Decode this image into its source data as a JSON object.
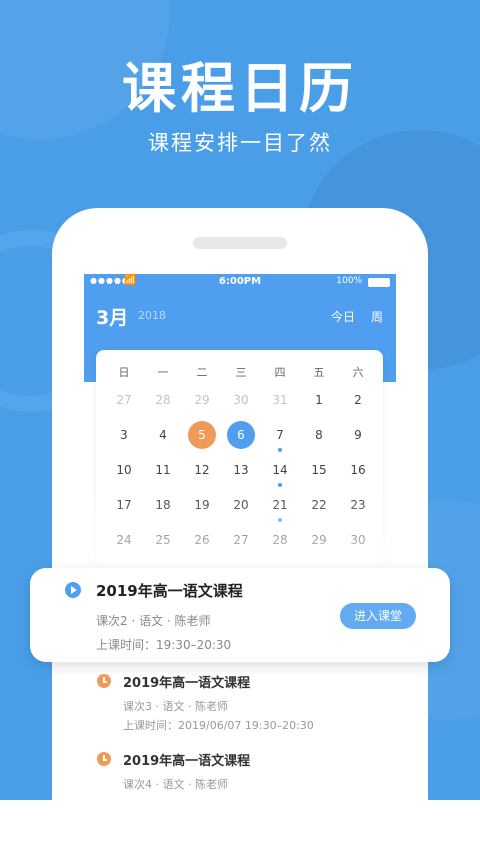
{
  "header": {
    "title": "课程日历",
    "subtitle": "课程安排一目了然"
  },
  "status_bar": {
    "signal": "●●●●●",
    "time": "6:00PM",
    "battery": "100%"
  },
  "calendar": {
    "month": "3月",
    "year": "2018",
    "today_label": "今日",
    "week_label": "周",
    "weekdays": [
      "日",
      "一",
      "二",
      "三",
      "四",
      "五",
      "六"
    ],
    "weeks": [
      [
        "27",
        "28",
        "29",
        "30",
        "31",
        "1",
        "2"
      ],
      [
        "3",
        "4",
        "5",
        "6",
        "7",
        "8",
        "9"
      ],
      [
        "10",
        "11",
        "12",
        "13",
        "14",
        "15",
        "16"
      ],
      [
        "17",
        "18",
        "19",
        "20",
        "21",
        "22",
        "23"
      ],
      [
        "24",
        "25",
        "26",
        "27",
        "28",
        "29",
        "30"
      ]
    ],
    "prev_month_days": 5,
    "highlight_orange": "5",
    "highlight_blue": "6",
    "dot_days": [
      "7",
      "14",
      "21"
    ]
  },
  "highlighted_course": {
    "title": "2019年高一语文课程",
    "meta": "课次2 · 语文 · 陈老师",
    "time": "上课时间：19:30–20:30",
    "enter_label": "进入课堂"
  },
  "course_list": [
    {
      "title": "2019年高一语文课程",
      "meta": "课次3 · 语文 · 陈老师",
      "time": "上课时间：2019/06/07 19:30–20:30"
    },
    {
      "title": "2019年高一语文课程",
      "meta": "课次4 · 语文 · 陈老师"
    }
  ],
  "colors": {
    "primary": "#4f9ef0",
    "accent_orange": "#ef9b57",
    "background": "#4a9ee8"
  }
}
